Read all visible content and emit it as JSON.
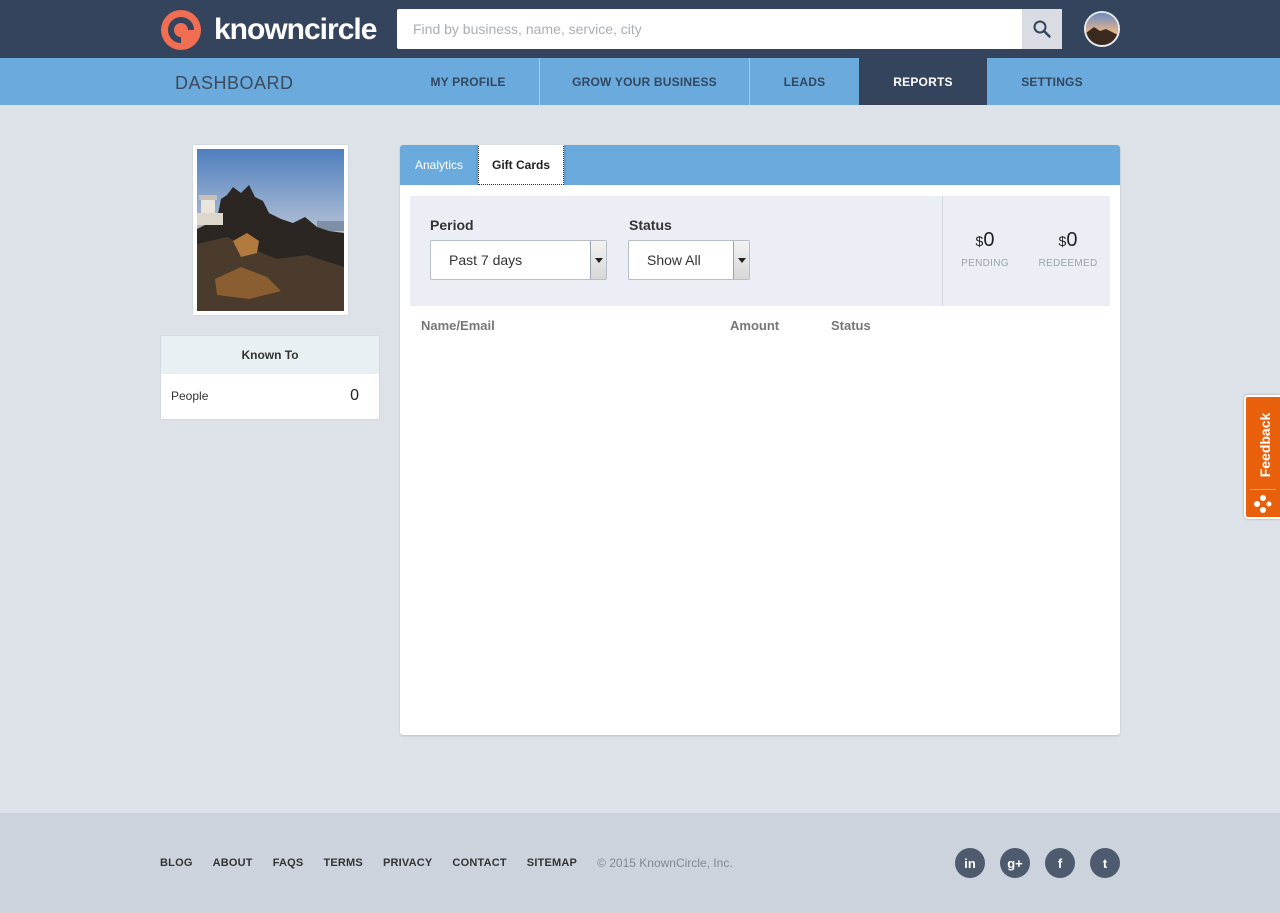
{
  "brand": {
    "name": "knowncircle",
    "accent": "#f26e52"
  },
  "search": {
    "placeholder": "Find by business, name, service, city"
  },
  "nav": {
    "title": "DASHBOARD",
    "items": [
      {
        "label": "MY PROFILE"
      },
      {
        "label": "GROW YOUR BUSINESS"
      },
      {
        "label": "LEADS"
      },
      {
        "label": "REPORTS",
        "active": true
      },
      {
        "label": "SETTINGS"
      }
    ]
  },
  "known_to": {
    "title": "Known To",
    "label": "People",
    "count": "0"
  },
  "tabs": [
    {
      "label": "Analytics"
    },
    {
      "label": "Gift Cards",
      "active": true
    }
  ],
  "filters": {
    "period": {
      "label": "Period",
      "value": "Past 7 days"
    },
    "status": {
      "label": "Status",
      "value": "Show All"
    }
  },
  "summary": {
    "currency": "$",
    "pending": {
      "amount": "0",
      "label": "PENDING"
    },
    "redeemed": {
      "amount": "0",
      "label": "REDEEMED"
    }
  },
  "table": {
    "columns": [
      "Name/Email",
      "Amount",
      "Status"
    ]
  },
  "feedback": {
    "label": "Feedback"
  },
  "footer": {
    "links": [
      "BLOG",
      "ABOUT",
      "FAQS",
      "TERMS",
      "PRIVACY",
      "CONTACT",
      "SITEMAP"
    ],
    "copyright": "© 2015 KnownCircle, Inc.",
    "social": [
      {
        "icon": "linkedin-icon",
        "glyph": "in"
      },
      {
        "icon": "google-plus-icon",
        "glyph": "g+"
      },
      {
        "icon": "facebook-icon",
        "glyph": "f"
      },
      {
        "icon": "twitter-icon",
        "glyph": "t"
      }
    ]
  }
}
